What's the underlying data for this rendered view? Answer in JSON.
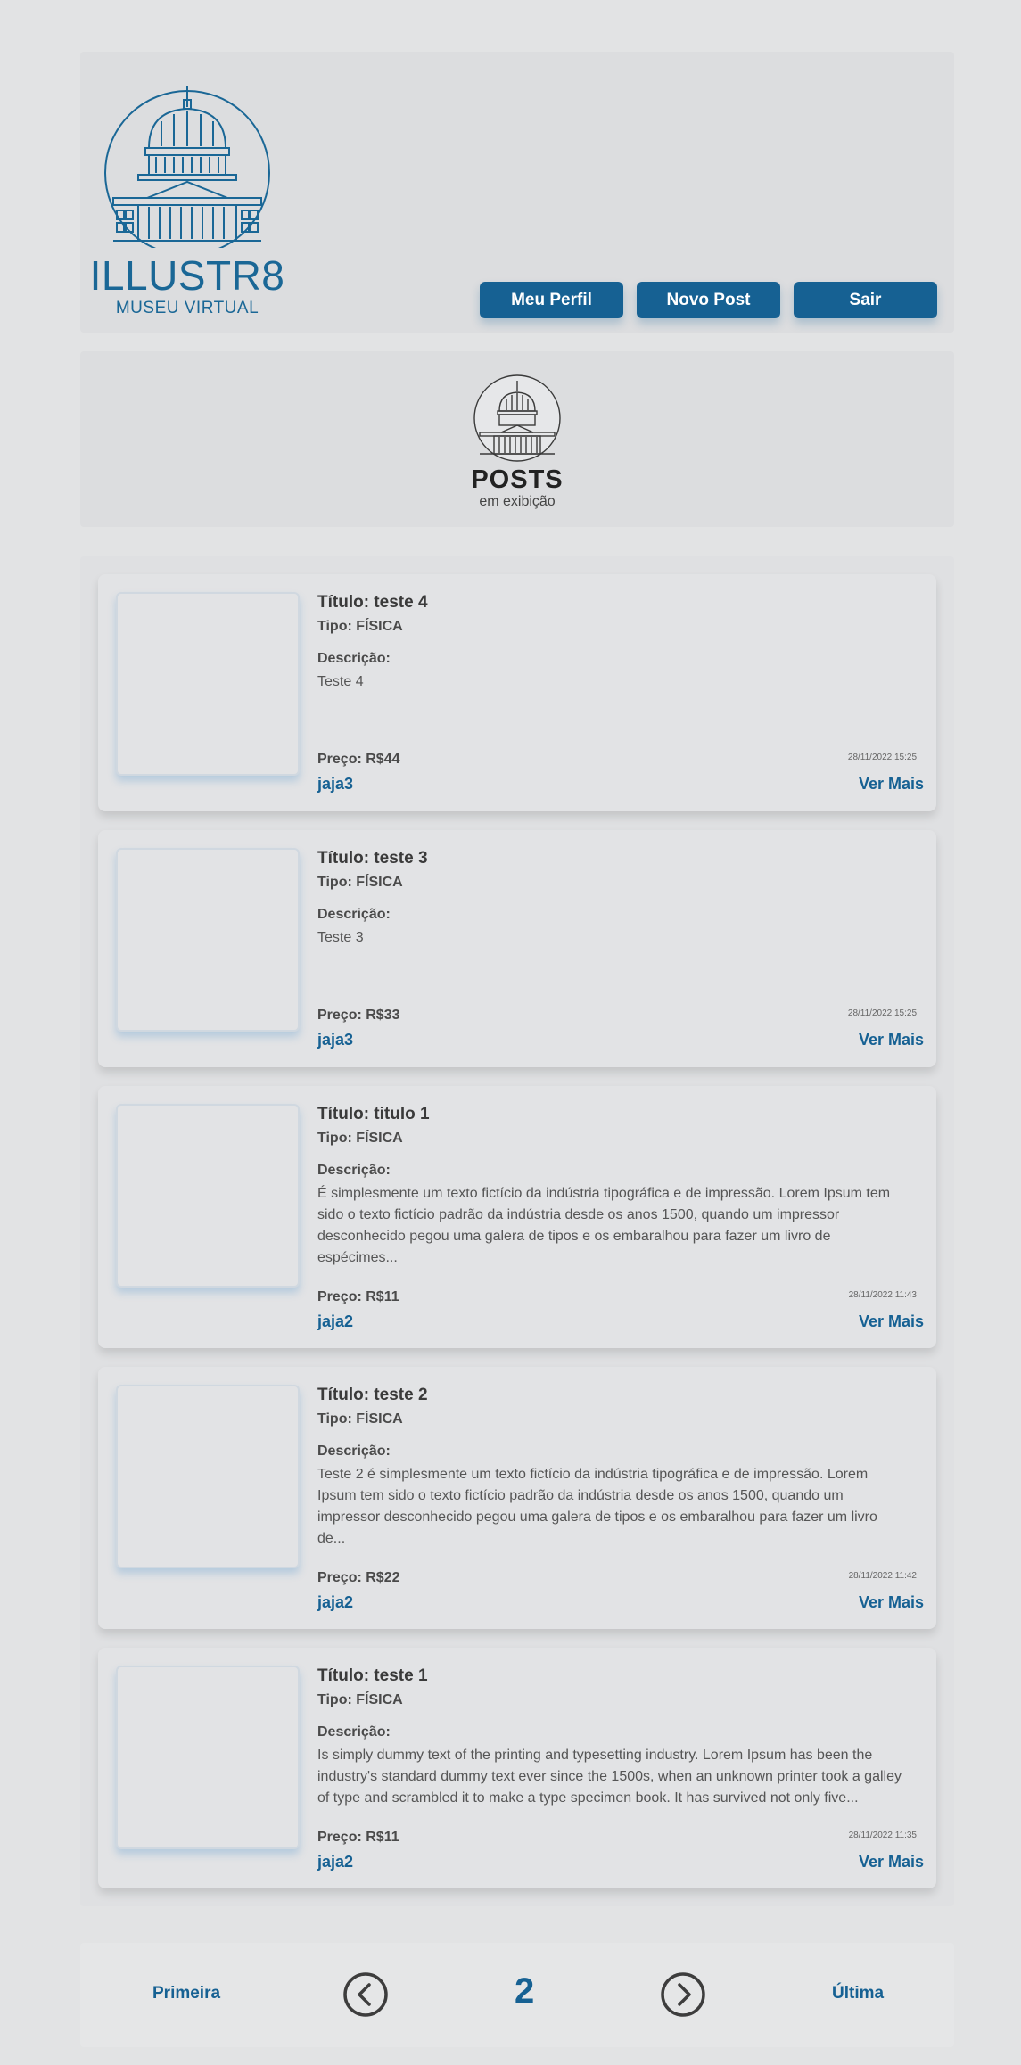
{
  "brand": {
    "name": "ILLUSTR8",
    "subtitle": "MUSEU VIRTUAL"
  },
  "nav": {
    "profile": "Meu Perfil",
    "new_post": "Novo Post",
    "logout": "Sair"
  },
  "banner": {
    "title": "POSTS",
    "subtitle": "em exibição"
  },
  "labels": {
    "description": "Descrição:",
    "see_more": "Ver Mais"
  },
  "posts": [
    {
      "title": "Título: teste 4",
      "type": "Tipo: FÍSICA",
      "description": "Teste 4",
      "price": "Preço: R$44",
      "date": "28/11/2022 15:25",
      "user": "jaja3"
    },
    {
      "title": "Título: teste 3",
      "type": "Tipo: FÍSICA",
      "description": "Teste 3",
      "price": "Preço: R$33",
      "date": "28/11/2022 15:25",
      "user": "jaja3"
    },
    {
      "title": "Título: titulo 1",
      "type": "Tipo: FÍSICA",
      "description": "É simplesmente um texto fictício da indústria tipográfica e de impressão. Lorem Ipsum tem sido o texto fictício padrão da indústria desde os anos 1500, quando um impressor desconhecido pegou uma galera de tipos e os embaralhou para fazer um livro de espécimes...",
      "price": "Preço: R$11",
      "date": "28/11/2022 11:43",
      "user": "jaja2"
    },
    {
      "title": "Título: teste 2",
      "type": "Tipo: FÍSICA",
      "description": "Teste 2 é simplesmente um texto fictício da indústria tipográfica e de impressão. Lorem Ipsum tem sido o texto fictício padrão da indústria desde os anos 1500, quando um impressor desconhecido pegou uma galera de tipos e os embaralhou para fazer um livro de...",
      "price": "Preço: R$22",
      "date": "28/11/2022 11:42",
      "user": "jaja2"
    },
    {
      "title": "Título: teste 1",
      "type": "Tipo: FÍSICA",
      "description": "Is simply dummy text of the printing and typesetting industry. Lorem Ipsum has been the industry's standard dummy text ever since the 1500s, when an unknown printer took a galley of type and scrambled it to make a type specimen book. It has survived not only five...",
      "price": "Preço: R$11",
      "date": "28/11/2022 11:35",
      "user": "jaja2"
    }
  ],
  "pagination": {
    "first": "Primeira",
    "current": "2",
    "last": "Última"
  },
  "colors": {
    "accent": "#166193",
    "background": "#e2e3e4"
  }
}
